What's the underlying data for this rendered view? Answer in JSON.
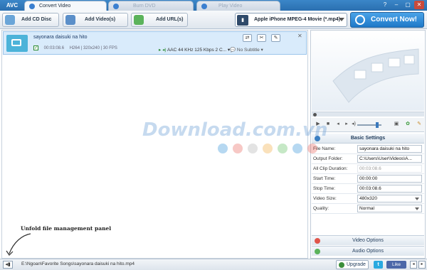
{
  "app": {
    "logo": "AVC",
    "tabs": [
      {
        "label": "Convert Video",
        "active": true,
        "icon": "convert-tab-icon",
        "color": "#3a7fd0"
      },
      {
        "label": "Burn DVD",
        "active": false,
        "icon": "dvd-tab-icon",
        "color": "#3a7fd0"
      },
      {
        "label": "Play Video",
        "active": false,
        "icon": "play-tab-icon",
        "color": "#3a7fd0"
      }
    ],
    "window_buttons": [
      "?",
      "–",
      "▢",
      "✕"
    ]
  },
  "toolbar": {
    "add_cd": "Add CD Disc",
    "add_video": "Add Video(s)",
    "add_url": "Add URL(s)",
    "profile": "Apple iPhone MPEG-4 Movie (*.mp4)",
    "convert": "Convert Now!"
  },
  "file": {
    "name": "sayonara daisuki na hito",
    "duration": "00:03:08.6",
    "video_info": "H264 | 320x240 | 30 FPS",
    "audio": "AAC 44 KHz 125 Kbps 2 C...",
    "subtitle": "No Subtitle"
  },
  "hint": "Unfold file management panel",
  "status": {
    "path": "E:\\Ngoan\\Favorite Songs\\sayonara daisuki na hito.mp4",
    "upgrade": "Upgrade",
    "twitter": "t",
    "like": "Like"
  },
  "settings_panel": {
    "header": "Basic Settings",
    "rows": [
      {
        "key": "File Name:",
        "value": "sayonara daisuki na hito"
      },
      {
        "key": "Output Folder:",
        "value": "C:\\Users\\User\\Videos\\A..."
      },
      {
        "key": "All Clip Duration:",
        "value": "00:03:08.6"
      },
      {
        "key": "Start Time:",
        "value": "00:00:00"
      },
      {
        "key": "Stop Time:",
        "value": "00:03:08.6"
      },
      {
        "key": "Video Size:",
        "value": "480x320"
      },
      {
        "key": "Quality:",
        "value": "Normal"
      }
    ],
    "video_options": "Video Options",
    "audio_options": "Audio Options"
  },
  "watermark": {
    "text": "Download.com.vn",
    "dot_colors": [
      "#2f8ed8",
      "#e8625a",
      "#b0b0b0",
      "#f2a93b",
      "#5bbd5b",
      "#2f8ed8",
      "#e8625a"
    ]
  }
}
